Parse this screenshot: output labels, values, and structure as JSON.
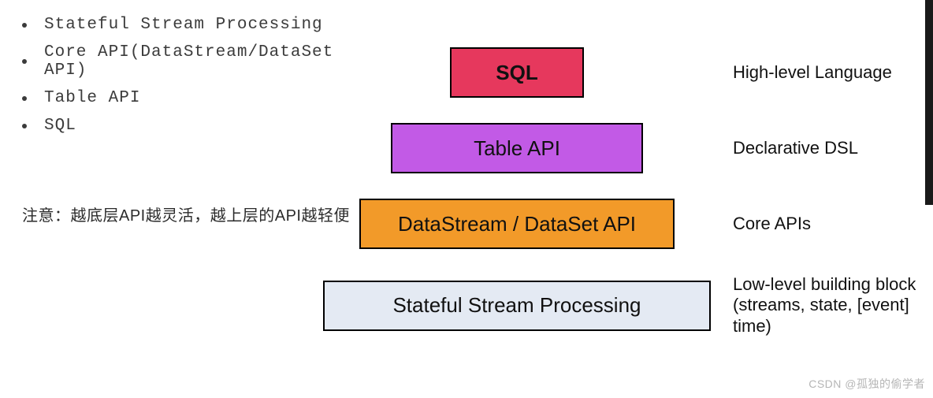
{
  "bullets": {
    "b0": "Stateful Stream Processing",
    "b1": "Core API(DataStream/DataSet API)",
    "b2": "Table API",
    "b3": "SQL"
  },
  "note": "注意：越底层API越灵活，越上层的API越轻便",
  "layers": {
    "l0": {
      "label": "SQL",
      "desc": "High-level Language"
    },
    "l1": {
      "label": "Table API",
      "desc": "Declarative DSL"
    },
    "l2": {
      "label": "DataStream / DataSet API",
      "desc": "Core APIs"
    },
    "l3": {
      "label": "Stateful Stream Processing",
      "desc": "Low-level building block (streams, state, [event] time)"
    }
  },
  "watermark": "CSDN @孤独的偷学者"
}
